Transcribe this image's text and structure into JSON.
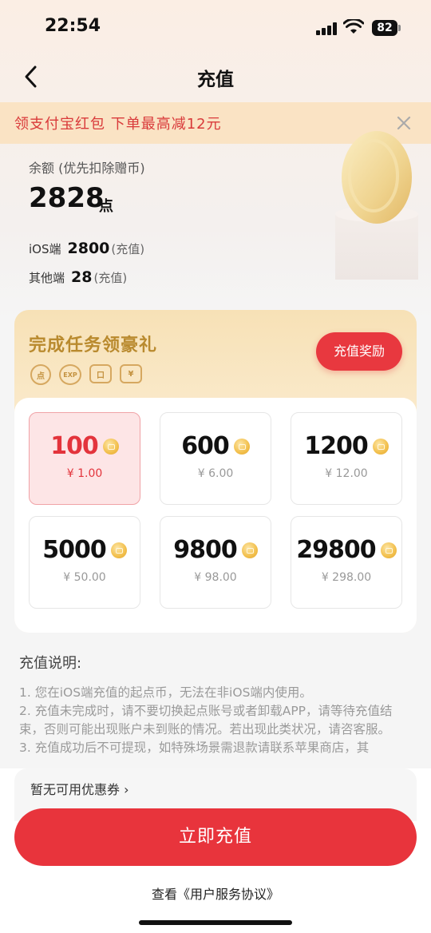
{
  "status_bar": {
    "time": "22:54",
    "battery": "82"
  },
  "nav": {
    "title": "充值"
  },
  "promo": {
    "text": "领支付宝红包 下单最高减12元"
  },
  "balance": {
    "label": "余额 (优先扣除赠币)",
    "value": "2828",
    "unit": "点",
    "ios_label": "iOS端",
    "ios_value": "2800",
    "ios_tag": "(充值)",
    "other_label": "其他端",
    "other_value": "28",
    "other_tag": "(充值)"
  },
  "task": {
    "title": "完成任务领豪礼",
    "reward_button": "充值奖励",
    "icons": [
      {
        "name": "point-icon",
        "glyph": "点"
      },
      {
        "name": "exp-icon",
        "glyph": "EXP"
      },
      {
        "name": "ticket-icon",
        "glyph": "口"
      },
      {
        "name": "yuan-icon",
        "glyph": "¥"
      }
    ]
  },
  "packages": [
    {
      "amount": "100",
      "price": "¥ 1.00",
      "selected": true
    },
    {
      "amount": "600",
      "price": "¥ 6.00",
      "selected": false
    },
    {
      "amount": "1200",
      "price": "¥ 12.00",
      "selected": false
    },
    {
      "amount": "5000",
      "price": "¥ 50.00",
      "selected": false
    },
    {
      "amount": "9800",
      "price": "¥ 98.00",
      "selected": false
    },
    {
      "amount": "29800",
      "price": "¥ 298.00",
      "selected": false
    }
  ],
  "notes": {
    "title": "充值说明:",
    "line1": "1. 您在iOS端充值的起点币，无法在非iOS端内使用。",
    "line2": "2. 充值未完成时，请不要切换起点账号或者卸载APP，请等待充值结束，否则可能出现账户未到账的情况。若出现此类状况，请咨客服。",
    "line3": "3. 充值成功后不可提现，如特殊场景需退款请联系苹果商店，其"
  },
  "coupon": {
    "text": "暂无可用优惠券 ›"
  },
  "cta": {
    "label": "立即充值"
  },
  "agreement": {
    "text": "查看《用户服务协议》"
  },
  "colors": {
    "accent": "#e8343c",
    "gold": "#b98a2e",
    "promo_bg": "#fae3c4"
  }
}
